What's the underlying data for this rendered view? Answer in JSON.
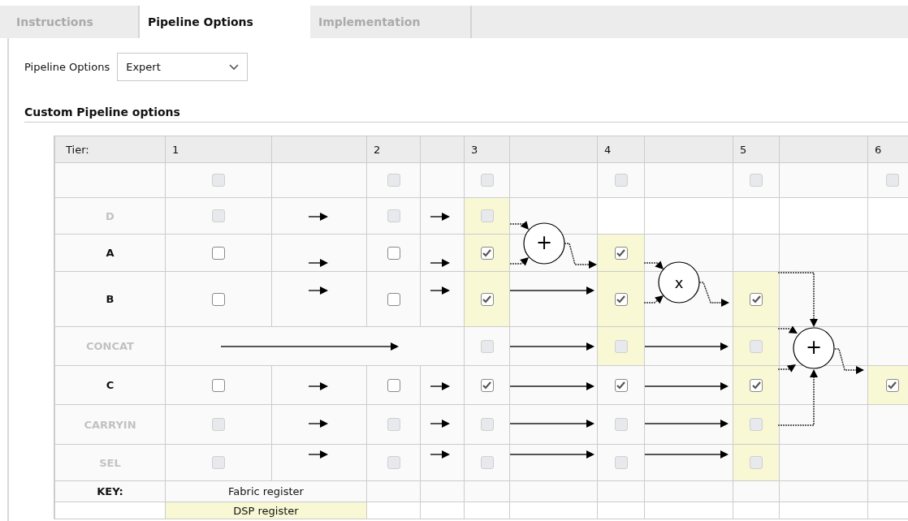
{
  "tabs": [
    {
      "label": "Instructions",
      "selected": false
    },
    {
      "label": "Pipeline Options",
      "selected": true
    },
    {
      "label": "Implementation",
      "selected": false
    }
  ],
  "pipeline_options": {
    "label": "Pipeline Options",
    "value": "Expert"
  },
  "section_title": "Custom Pipeline options",
  "table": {
    "tier_label": "Tier:",
    "tiers": [
      "1",
      "2",
      "3",
      "4",
      "5",
      "6"
    ],
    "rows": [
      {
        "cells": [
          {
            "checked": false,
            "disabled": true,
            "dsp": false
          },
          {
            "checked": false,
            "disabled": true,
            "dsp": false
          },
          {
            "checked": false,
            "disabled": true,
            "dsp": false
          },
          {
            "checked": false,
            "disabled": true,
            "dsp": false
          },
          {
            "checked": false,
            "disabled": true,
            "dsp": false
          },
          {
            "checked": false,
            "disabled": true,
            "dsp": false
          }
        ]
      },
      {
        "label": "D",
        "disabled": true,
        "cells": [
          {
            "checked": false,
            "disabled": true,
            "dsp": false
          },
          {
            "checked": false,
            "disabled": true,
            "dsp": false
          },
          {
            "checked": false,
            "disabled": true,
            "dsp": true
          },
          null,
          null,
          null
        ]
      },
      {
        "label": "A",
        "disabled": false,
        "cells": [
          {
            "checked": false,
            "disabled": false,
            "dsp": false
          },
          {
            "checked": false,
            "disabled": false,
            "dsp": false
          },
          {
            "checked": true,
            "disabled": false,
            "dsp": true
          },
          {
            "checked": true,
            "disabled": false,
            "dsp": true
          },
          null,
          null
        ]
      },
      {
        "label": "B",
        "disabled": false,
        "cells": [
          {
            "checked": false,
            "disabled": false,
            "dsp": false
          },
          {
            "checked": false,
            "disabled": false,
            "dsp": false
          },
          {
            "checked": true,
            "disabled": false,
            "dsp": true
          },
          {
            "checked": true,
            "disabled": false,
            "dsp": true
          },
          {
            "checked": true,
            "disabled": false,
            "dsp": true
          },
          null
        ]
      },
      {
        "label": "CONCAT",
        "disabled": true,
        "cells": [
          null,
          null,
          {
            "checked": false,
            "disabled": true,
            "dsp": false
          },
          {
            "checked": false,
            "disabled": true,
            "dsp": true
          },
          {
            "checked": false,
            "disabled": true,
            "dsp": true
          },
          null
        ]
      },
      {
        "label": "C",
        "disabled": false,
        "cells": [
          {
            "checked": false,
            "disabled": false,
            "dsp": false
          },
          {
            "checked": false,
            "disabled": false,
            "dsp": false
          },
          {
            "checked": true,
            "disabled": false,
            "dsp": false
          },
          {
            "checked": true,
            "disabled": false,
            "dsp": false
          },
          {
            "checked": true,
            "disabled": false,
            "dsp": true
          },
          {
            "checked": true,
            "disabled": false,
            "dsp": true
          }
        ]
      },
      {
        "label": "CARRYIN",
        "disabled": true,
        "cells": [
          {
            "checked": false,
            "disabled": true,
            "dsp": false
          },
          {
            "checked": false,
            "disabled": true,
            "dsp": false
          },
          {
            "checked": false,
            "disabled": true,
            "dsp": false
          },
          {
            "checked": false,
            "disabled": true,
            "dsp": false
          },
          {
            "checked": false,
            "disabled": true,
            "dsp": true
          },
          null
        ]
      },
      {
        "label": "SEL",
        "disabled": true,
        "cells": [
          {
            "checked": false,
            "disabled": true,
            "dsp": false
          },
          {
            "checked": false,
            "disabled": true,
            "dsp": false
          },
          {
            "checked": false,
            "disabled": true,
            "dsp": false
          },
          {
            "checked": false,
            "disabled": true,
            "dsp": false
          },
          {
            "checked": false,
            "disabled": true,
            "dsp": true
          },
          null
        ]
      }
    ],
    "operators": [
      {
        "symbol": "+"
      },
      {
        "symbol": "x"
      },
      {
        "symbol": "+"
      }
    ],
    "key_label": "KEY:",
    "key": [
      {
        "text": "Fabric register",
        "dsp": false
      },
      {
        "text": "DSP register",
        "dsp": true
      }
    ]
  }
}
